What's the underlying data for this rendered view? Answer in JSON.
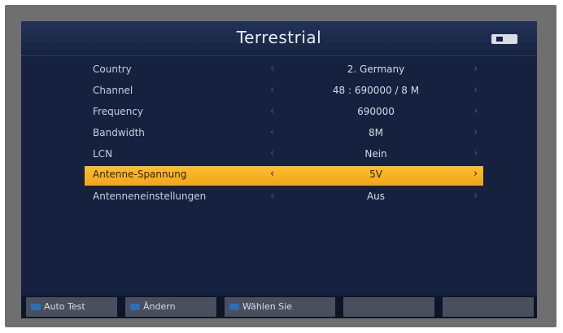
{
  "screen": {
    "title": "Terrestrial"
  },
  "menu": {
    "items": [
      {
        "label": "Country",
        "value": "2. Germany"
      },
      {
        "label": "Channel",
        "value": "48 : 690000 / 8 M"
      },
      {
        "label": "Frequency",
        "value": "690000"
      },
      {
        "label": "Bandwidth",
        "value": "8M"
      },
      {
        "label": "LCN",
        "value": "Nein"
      },
      {
        "label": "Antenne-Spannung",
        "value": "5V",
        "selected": true
      },
      {
        "label": "Antenneneinstellungen",
        "value": "Aus"
      }
    ],
    "arrow_left": "‹",
    "arrow_right": "›"
  },
  "footer": {
    "buttons": [
      {
        "label": "Auto Test"
      },
      {
        "label": "Ändern"
      },
      {
        "label": "Wählen Sie"
      }
    ]
  },
  "colors": {
    "screen_bg": "#16213f",
    "highlight": "#f7b225",
    "bezel": "#6f6f6f"
  }
}
